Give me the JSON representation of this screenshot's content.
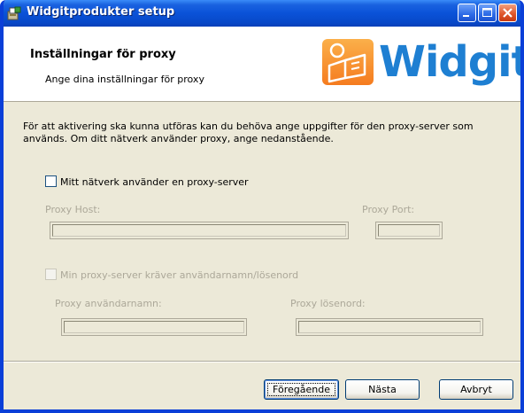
{
  "window": {
    "title": "Widgitprodukter setup"
  },
  "header": {
    "title": "Inställningar för proxy",
    "subtitle": "Ange dina inställningar för proxy",
    "logo_text": "Widgit"
  },
  "content": {
    "description": "För att aktivering ska kunna utföras kan du behöva ange uppgifter för den proxy-server som används. Om ditt nätverk använder proxy, ange nedanstående.",
    "use_proxy_label": "Mitt nätverk använder en proxy-server",
    "use_proxy_checked": false,
    "proxy_host_label": "Proxy Host:",
    "proxy_host_value": "",
    "proxy_port_label": "Proxy Port:",
    "proxy_port_value": "",
    "auth_label": "Min proxy-server kräver användarnamn/lösenord",
    "auth_checked": false,
    "username_label": "Proxy användarnamn:",
    "username_value": "",
    "password_label": "Proxy lösenord:",
    "password_value": ""
  },
  "buttons": {
    "back": "Föregående",
    "next": "Nästa",
    "cancel": "Avbryt"
  },
  "colors": {
    "titlebar": "#0a52d8",
    "logo_blue": "#1e7fd2",
    "logo_orange": "#f57c1f",
    "disabled_text": "#aca899",
    "dialog_bg": "#ece9d8"
  }
}
